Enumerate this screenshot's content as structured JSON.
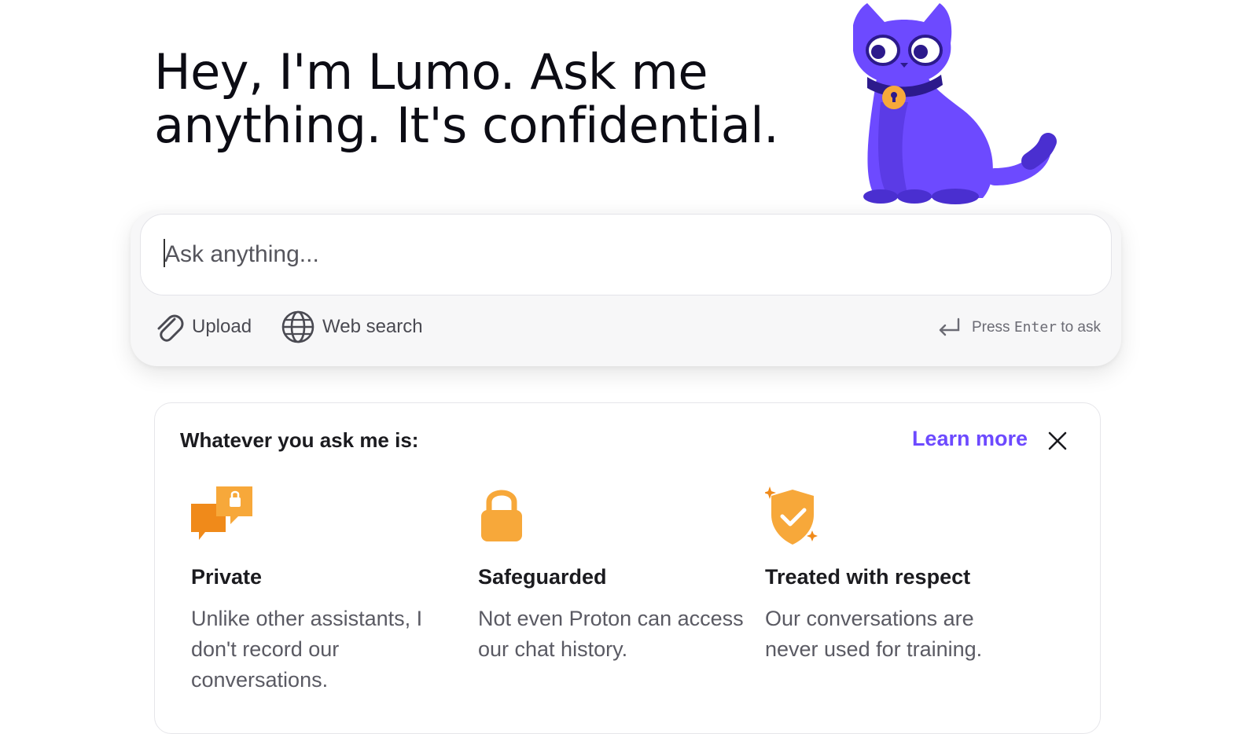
{
  "hero": {
    "title": "Hey, I'm Lumo. Ask me anything. It's confidential."
  },
  "mascot": {
    "icon": "cat-mascot-icon",
    "color": "#6d4aff"
  },
  "composer": {
    "placeholder": "Ask anything...",
    "upload_label": "Upload",
    "web_search_label": "Web search",
    "enter_hint_prefix": "Press",
    "enter_hint_key": "Enter",
    "enter_hint_suffix": "to ask"
  },
  "info_card": {
    "heading": "Whatever you ask me is:",
    "learn_more": "Learn more",
    "features": [
      {
        "icon": "private-chat-icon",
        "title": "Private",
        "description": "Unlike other assistants, I don't record our conversations."
      },
      {
        "icon": "lock-icon",
        "title": "Safeguarded",
        "description": "Not even Proton can access our chat history."
      },
      {
        "icon": "shield-check-icon",
        "title": "Treated with respect",
        "description": "Our conversations are never used for training."
      }
    ]
  },
  "colors": {
    "accent": "#6d4aff",
    "icon_orange": "#f7a83a",
    "icon_dark_orange": "#f08a1a"
  }
}
